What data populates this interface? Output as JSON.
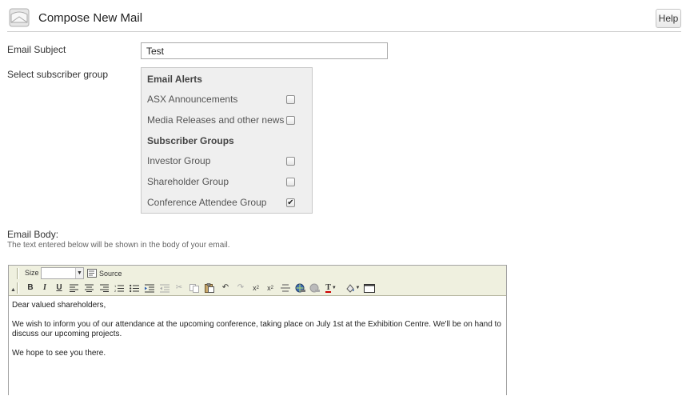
{
  "header": {
    "title": "Compose New Mail",
    "help_label": "Help"
  },
  "form": {
    "subject_label": "Email Subject",
    "subject_value": "Test",
    "group_label": "Select subscriber group",
    "body_label": "Email Body:",
    "body_hint": "The text entered below will be shown in the body of your email."
  },
  "groups": {
    "email_alerts_heading": "Email Alerts",
    "items": [
      {
        "label": "ASX Announcements",
        "checked": false
      },
      {
        "label": "Media Releases and other news",
        "checked": false
      }
    ],
    "subscriber_groups_heading": "Subscriber Groups",
    "sub_items": [
      {
        "label": "Investor Group",
        "checked": false
      },
      {
        "label": "Shareholder Group",
        "checked": false
      },
      {
        "label": "Conference Attendee Group",
        "checked": true
      }
    ]
  },
  "editor": {
    "size_label": "Size",
    "size_value": "",
    "source_label": "Source",
    "toolbar_icons": [
      "bold-icon",
      "italic-icon",
      "underline-icon",
      "align-left-icon",
      "align-center-icon",
      "align-right-icon",
      "ordered-list-icon",
      "unordered-list-icon",
      "indent-icon",
      "outdent-icon",
      "cut-icon",
      "copy-icon",
      "paste-icon",
      "undo-icon",
      "redo-icon",
      "subscript-icon",
      "superscript-icon",
      "horizontal-rule-icon",
      "link-icon",
      "unlink-icon",
      "text-color-icon",
      "background-color-icon",
      "maximize-icon"
    ],
    "paragraphs": [
      "Dear valued shareholders,",
      "We wish to inform you of our attendance at the upcoming conference, taking place on July 1st at the Exhibition Centre. We'll be on hand to discuss our upcoming projects.",
      "We hope to see you there."
    ]
  }
}
